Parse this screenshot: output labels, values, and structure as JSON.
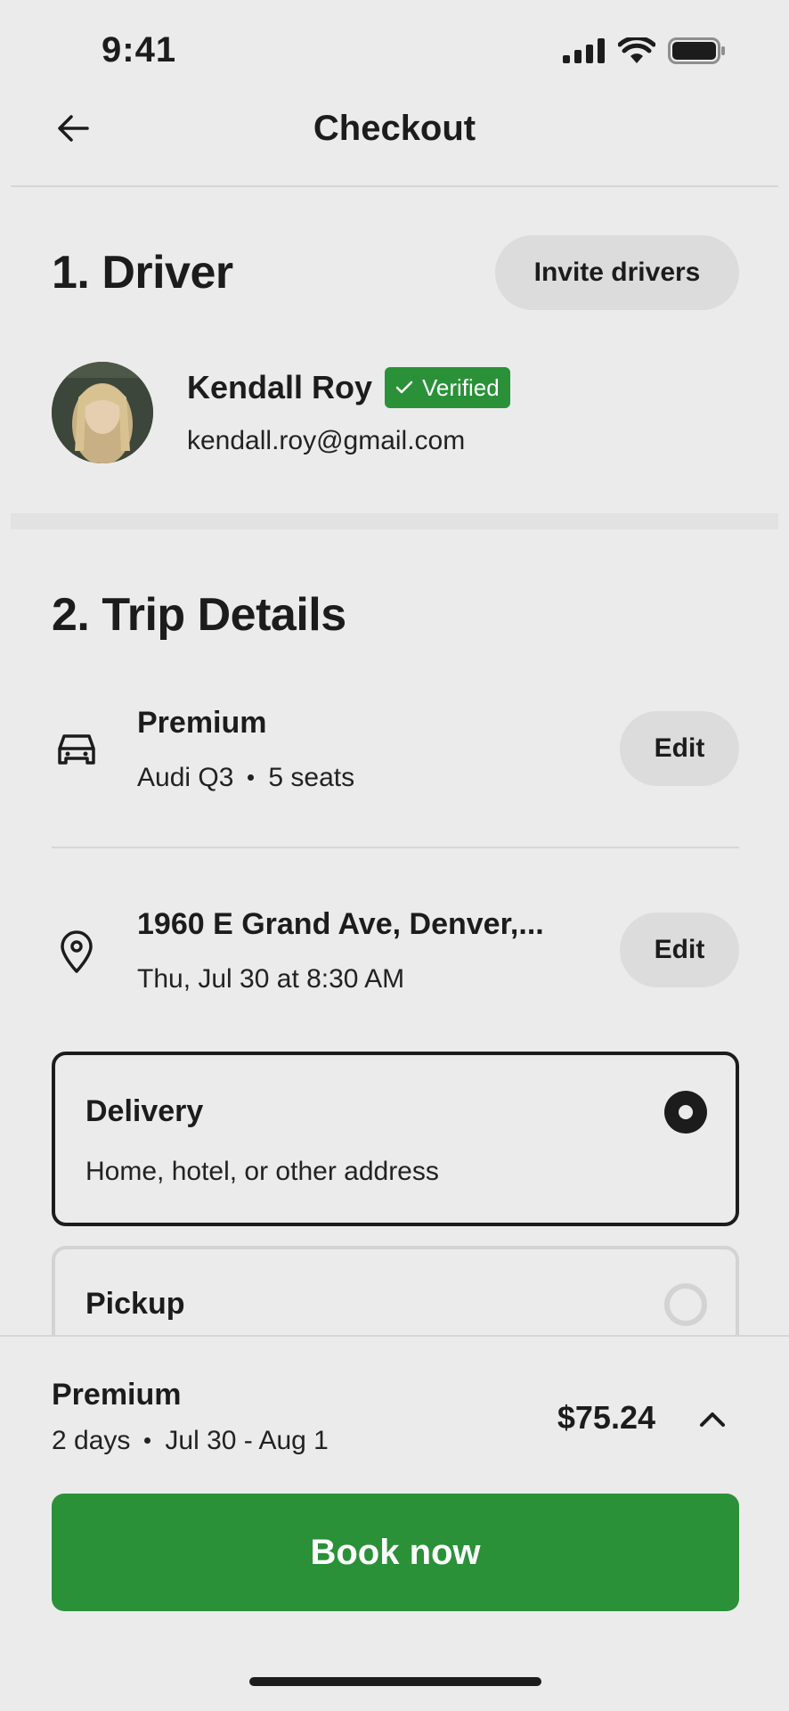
{
  "status_bar": {
    "time": "9:41"
  },
  "header": {
    "title": "Checkout"
  },
  "driver_section": {
    "title": "1. Driver",
    "invite_label": "Invite drivers",
    "driver": {
      "name": "Kendall Roy",
      "badge": "Verified",
      "email": "kendall.roy@gmail.com"
    }
  },
  "trip_section": {
    "title": "2. Trip Details",
    "vehicle": {
      "title": "Premium",
      "model": "Audi Q3",
      "seats": "5 seats",
      "edit_label": "Edit"
    },
    "location": {
      "address": "1960 E Grand Ave, Denver,...",
      "datetime": "Thu, Jul 30 at 8:30 AM",
      "edit_label": "Edit"
    },
    "options": [
      {
        "title": "Delivery",
        "subtitle": "Home, hotel, or other address",
        "selected": true
      },
      {
        "title": "Pickup",
        "selected": false
      }
    ]
  },
  "summary": {
    "title": "Premium",
    "duration": "2 days",
    "dates": "Jul 30 - Aug 1",
    "price": "$75.24",
    "book_label": "Book now"
  },
  "colors": {
    "accent": "#2a9138",
    "background": "#ebebeb",
    "text": "#1c1c1c"
  },
  "icons": [
    "arrow-left-icon",
    "signal-icon",
    "wifi-icon",
    "battery-icon",
    "check-icon",
    "car-icon",
    "map-pin-icon",
    "chevron-up-icon"
  ]
}
